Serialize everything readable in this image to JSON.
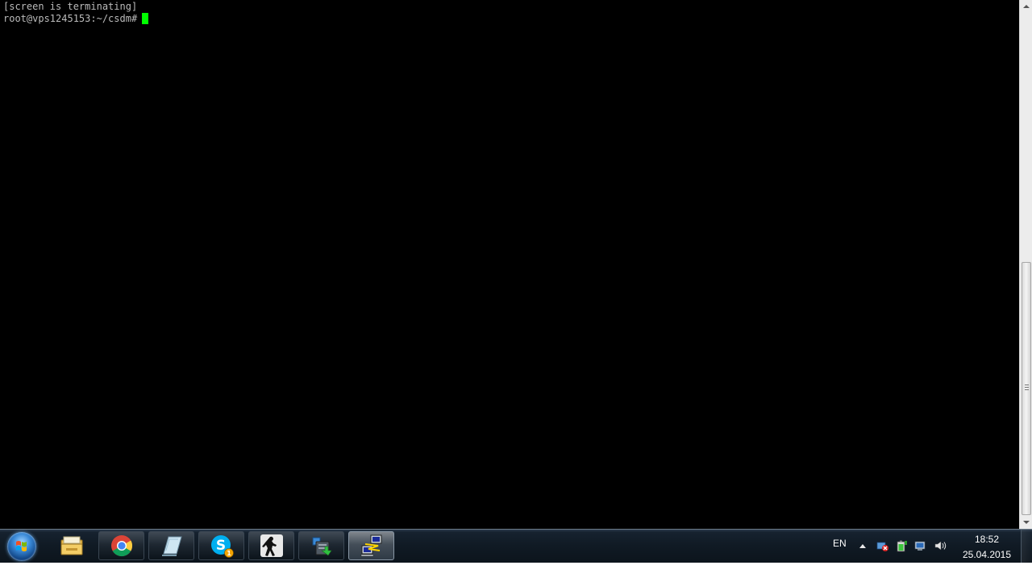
{
  "terminal": {
    "lines": [
      "[screen is terminating]",
      "root@vps1245153:~/csdm#"
    ],
    "text_color": "#bbbbbb",
    "background": "#000000",
    "cursor_color": "#00ff00"
  },
  "taskbar": {
    "start_icon": "windows-orb-icon",
    "apps": [
      {
        "icon": "windows-explorer-icon",
        "state": "pinned"
      },
      {
        "icon": "chrome-icon",
        "state": "open"
      },
      {
        "icon": "notepad-icon",
        "state": "open"
      },
      {
        "icon": "skype-icon",
        "state": "open",
        "badge": "1"
      },
      {
        "icon": "counter-strike-icon",
        "state": "open"
      },
      {
        "icon": "server-upload-icon",
        "state": "open"
      },
      {
        "icon": "putty-icon",
        "state": "active"
      }
    ],
    "tray": {
      "language": "EN",
      "icons": [
        "network-error-icon",
        "battery-icon",
        "network-icon",
        "volume-icon"
      ]
    },
    "clock": {
      "time": "18:52",
      "date": "25.04.2015"
    }
  }
}
